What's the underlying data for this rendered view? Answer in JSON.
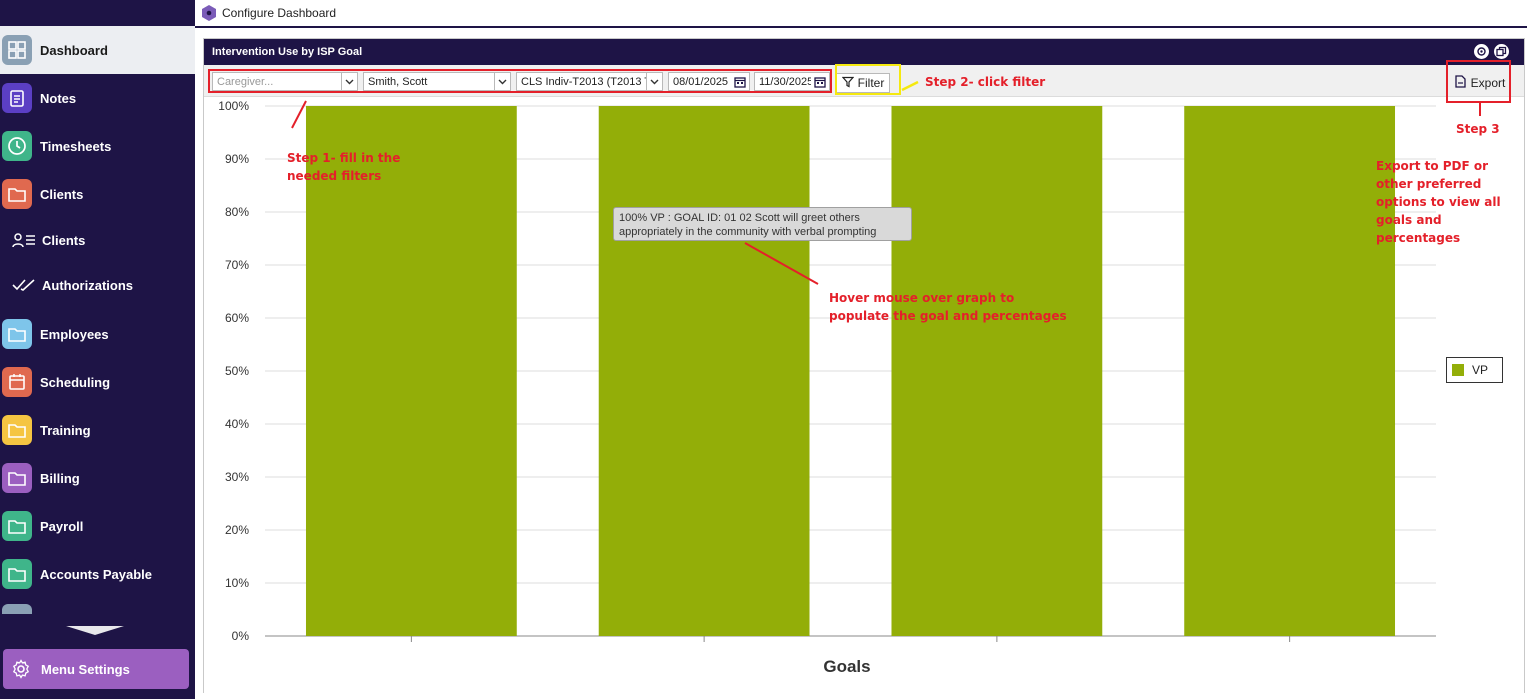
{
  "sidebar": {
    "items": [
      {
        "label": "Dashboard",
        "icon": "grid-icon",
        "color": "#8aa0b4",
        "active": true
      },
      {
        "label": "Notes",
        "icon": "clipboard-icon",
        "color": "#5b3fc4"
      },
      {
        "label": "Timesheets",
        "icon": "clock-icon",
        "color": "#3fb58a"
      },
      {
        "label": "Clients",
        "icon": "folder-icon",
        "color": "#e0694f"
      },
      {
        "label": "Clients",
        "icon": "user-list-icon",
        "sub": true
      },
      {
        "label": "Authorizations",
        "icon": "double-check-icon",
        "sub": true
      },
      {
        "label": "Employees",
        "icon": "folder-icon",
        "color": "#7ec5ea"
      },
      {
        "label": "Scheduling",
        "icon": "calendar-icon",
        "color": "#e0694f"
      },
      {
        "label": "Training",
        "icon": "folder-icon",
        "color": "#f5c542"
      },
      {
        "label": "Billing",
        "icon": "folder-icon",
        "color": "#9b5fc0"
      },
      {
        "label": "Payroll",
        "icon": "folder-icon",
        "color": "#3fb58a"
      },
      {
        "label": "Accounts Payable",
        "icon": "folder-icon",
        "color": "#3fb58a"
      }
    ],
    "menu_settings": "Menu Settings"
  },
  "topbar": {
    "title": "Configure Dashboard"
  },
  "panel": {
    "title": "Intervention Use by ISP Goal",
    "filters": {
      "caregiver_placeholder": "Caregiver...",
      "client": "Smith, Scott",
      "service": "CLS Indiv-T2013 (T2013 T",
      "start_date": "08/01/2025",
      "end_date": "11/30/2025"
    },
    "filter_label": "Filter",
    "export_label": "Export"
  },
  "chart_data": {
    "type": "bar",
    "categories": [
      "",
      "",
      "",
      ""
    ],
    "series": [
      {
        "name": "VP",
        "values": [
          100,
          100,
          100,
          100
        ]
      }
    ],
    "xlabel": "Goals",
    "ylabel": "",
    "ylim": [
      0,
      100
    ],
    "y_ticks": [
      "0%",
      "10%",
      "20%",
      "30%",
      "40%",
      "50%",
      "60%",
      "70%",
      "80%",
      "90%",
      "100%"
    ],
    "legend": "right",
    "grid": true,
    "bar_color": "#93ae08",
    "tooltip": "100% VP : GOAL ID: 01 02 Scott will greet others appropriately in the community with verbal prompting"
  },
  "annotations": {
    "step1": "Step 1- fill in the needed filters",
    "step2": "Step 2- click filter",
    "step3": "Step 3",
    "export_note": "Export to PDF or other preferred options to view all goals and percentages",
    "hover_note": "Hover mouse over graph to populate the goal and percentages",
    "color": "#e4202a",
    "highlight_color": "#f5e90f"
  }
}
